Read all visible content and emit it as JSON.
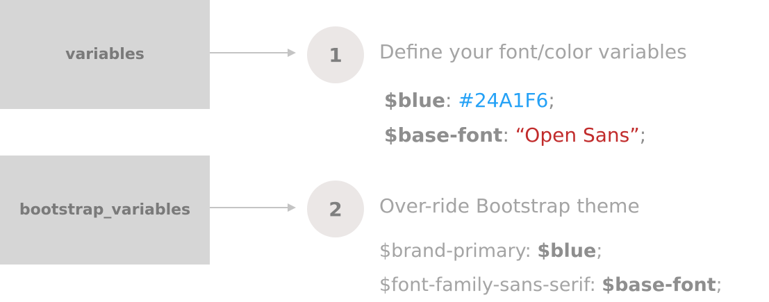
{
  "boxes": [
    {
      "label": "variables"
    },
    {
      "label": "bootstrap_variables"
    }
  ],
  "steps": [
    {
      "number": "1",
      "heading": "Define your font/color variables"
    },
    {
      "number": "2",
      "heading": "Over-ride Bootstrap theme"
    }
  ],
  "code": {
    "line1": {
      "name": "$blue",
      "sep": ": ",
      "value": "#24A1F6",
      "end": ";"
    },
    "line2": {
      "name": "$base-font",
      "sep": ": ",
      "value": "“Open Sans”",
      "end": ";"
    },
    "line3": {
      "name": "$brand-primary",
      "sep": ": ",
      "value": "$blue",
      "end": ";"
    },
    "line4": {
      "name": "$font-family-sans-serif",
      "sep": ": ",
      "value": "$base-font",
      "end": ";"
    }
  },
  "colors": {
    "box_bg": "#d6d6d6",
    "circle_bg": "#ebe7e6",
    "blue_value": "#24a1f6",
    "red_value": "#c12b2b",
    "text_gray": "#8e8e8e"
  }
}
